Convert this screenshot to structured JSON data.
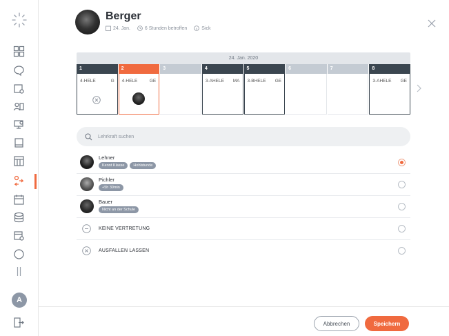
{
  "header": {
    "name": "Berger",
    "date": "24. Jan.",
    "hours": "6 Stunden betroffen",
    "status": "Sick"
  },
  "timetable": {
    "date": "24. Jan. 2020",
    "periods": [
      {
        "num": "1",
        "state": "dark",
        "label": "4-HELE",
        "code": "G",
        "cell": "x-icon"
      },
      {
        "num": "2",
        "state": "orange",
        "label": "4-HELE",
        "code": "GE",
        "cell": "teacher-photo"
      },
      {
        "num": "3",
        "state": "light",
        "label": "",
        "code": "",
        "cell": ""
      },
      {
        "num": "4",
        "state": "dark",
        "label": "3-AHELE",
        "code": "MA",
        "cell": ""
      },
      {
        "num": "5",
        "state": "dark",
        "label": "3-BHELE",
        "code": "GE",
        "cell": ""
      },
      {
        "num": "6",
        "state": "light",
        "label": "",
        "code": "",
        "cell": ""
      },
      {
        "num": "7",
        "state": "light",
        "label": "",
        "code": "",
        "cell": ""
      },
      {
        "num": "8",
        "state": "dark",
        "label": "3-AHELE",
        "code": "GE",
        "cell": ""
      }
    ]
  },
  "search": {
    "placeholder": "Lehrkraft suchen"
  },
  "teachers": [
    {
      "name": "Lehner",
      "tags": [
        "Kennt Klasse",
        "Hohlstunde"
      ],
      "selected": true
    },
    {
      "name": "Pichler",
      "tags": [
        "+5h 30min"
      ],
      "selected": false
    },
    {
      "name": "Bauer",
      "tags": [
        "Nicht an der Schule"
      ],
      "selected": false
    }
  ],
  "options": [
    {
      "label": "KEINE VERTRETUNG",
      "icon": "minus-circle-icon"
    },
    {
      "label": "AUSFALLEN LASSEN",
      "icon": "x-circle-icon"
    }
  ],
  "sidebar": {
    "user_initial": "A",
    "active_index": 7,
    "icons": [
      "dashboard-icon",
      "chat-icon",
      "calendar-settings-icon",
      "users-icon",
      "monitor-settings-icon",
      "tablet-icon",
      "calendar-grid-icon",
      "substitution-icon",
      "calendar-icon",
      "database-icon",
      "calendar-gear-icon",
      "circle-icon",
      "pause-icon"
    ]
  },
  "footer": {
    "cancel": "Abbrechen",
    "save": "Speichern"
  },
  "colors": {
    "accent": "#f06a3f",
    "dark": "#3b4650",
    "light": "#c4cbd3"
  }
}
